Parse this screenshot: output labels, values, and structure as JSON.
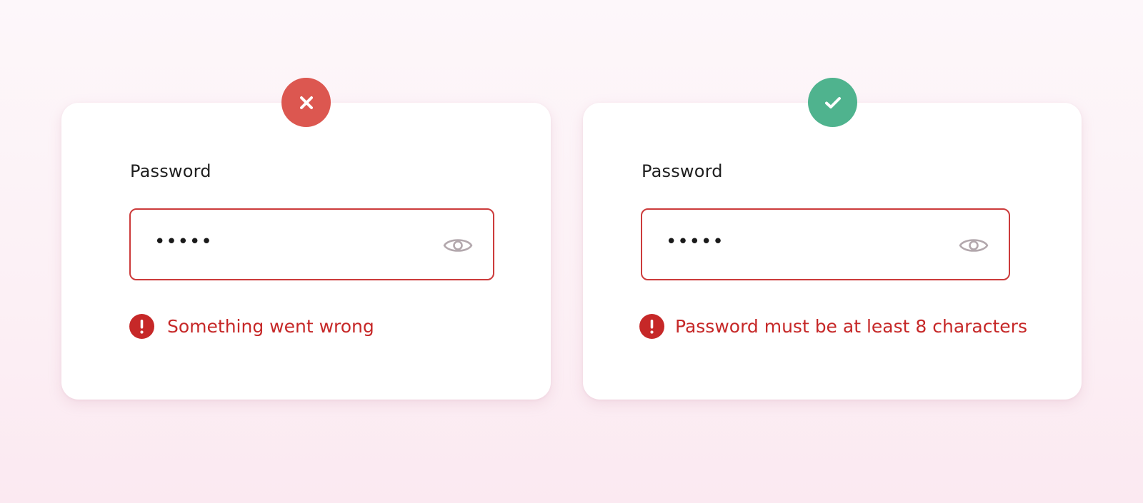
{
  "colors": {
    "error": "#c62828",
    "error_badge": "#dc5750",
    "success_badge": "#4fb38e",
    "input_border": "#cc3b3b",
    "eye_icon": "#b3a8ad"
  },
  "cards": [
    {
      "status_icon": "x-icon",
      "field_label": "Password",
      "input_value": "•••••",
      "visibility_icon": "eye-icon",
      "error_icon": "exclamation-icon",
      "error_message": "Something went wrong"
    },
    {
      "status_icon": "check-icon",
      "field_label": "Password",
      "input_value": "•••••",
      "visibility_icon": "eye-icon",
      "error_icon": "exclamation-icon",
      "error_message": "Password must be at least 8 characters"
    }
  ]
}
